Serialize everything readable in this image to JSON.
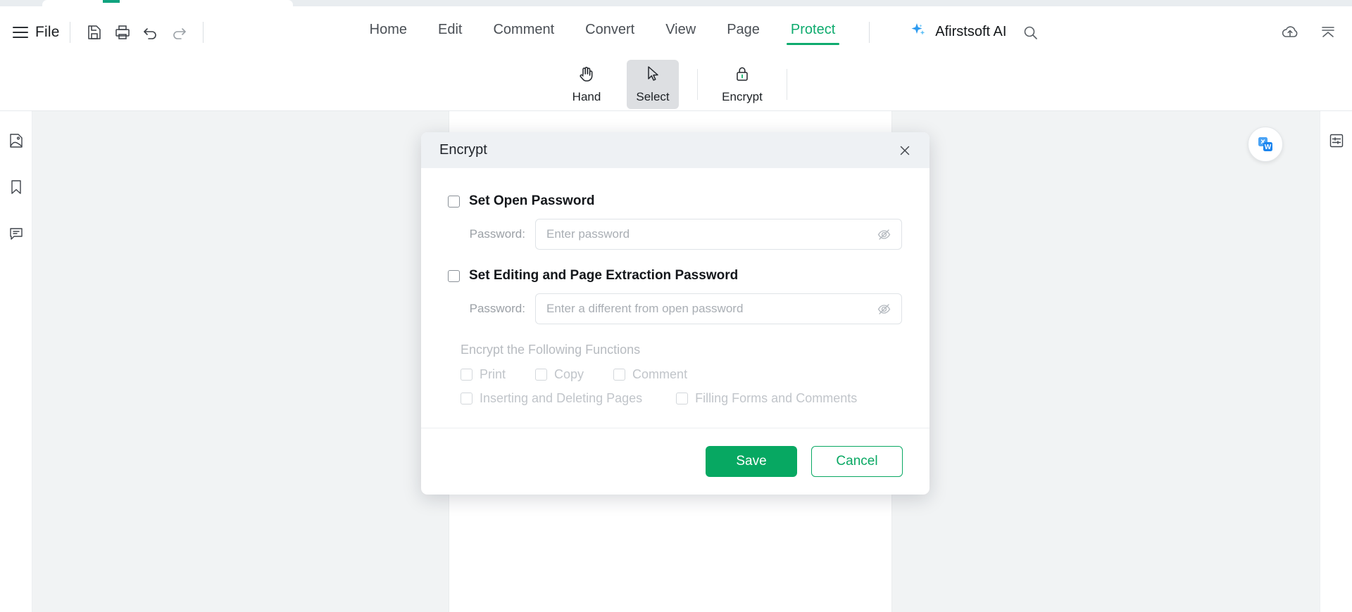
{
  "window": {
    "tab_accent_color": "#10a37f"
  },
  "header": {
    "file_label": "File",
    "icons": {
      "menu": "hamburger-menu-icon",
      "save": "save-file-icon",
      "print": "printer-icon",
      "undo": "undo-arrow-icon",
      "redo": "redo-arrow-icon",
      "search": "search-icon",
      "cloud": "cloud-upload-icon",
      "collapse": "collapse-ribbon-icon"
    },
    "tabs": [
      {
        "label": "Home",
        "active": false
      },
      {
        "label": "Edit",
        "active": false
      },
      {
        "label": "Comment",
        "active": false
      },
      {
        "label": "Convert",
        "active": false
      },
      {
        "label": "View",
        "active": false
      },
      {
        "label": "Page",
        "active": false
      },
      {
        "label": "Protect",
        "active": true
      }
    ],
    "ai": {
      "label": "Afirstsoft AI",
      "icon": "sparkle-ai-icon"
    },
    "accent_color": "#0eab6e"
  },
  "toolbar": {
    "tools": [
      {
        "label": "Hand",
        "icon": "hand-icon",
        "active": false
      },
      {
        "label": "Select",
        "icon": "cursor-arrow-icon",
        "active": true
      },
      {
        "label": "Encrypt",
        "icon": "lock-icon",
        "active": false
      }
    ]
  },
  "left_rail": {
    "items": [
      {
        "icon": "page-thumbnail-icon",
        "name": "thumbnails"
      },
      {
        "icon": "bookmark-icon",
        "name": "bookmarks"
      },
      {
        "icon": "comment-bubble-icon",
        "name": "comments"
      }
    ]
  },
  "right_rail": {
    "items": [
      {
        "icon": "properties-sliders-icon",
        "name": "properties"
      }
    ]
  },
  "canvas": {
    "convert_fab_icon": "pdf-to-word-icon",
    "background_color": "#f1f3f4"
  },
  "dialog": {
    "title": "Encrypt",
    "close_icon": "close-icon",
    "sections": [
      {
        "checkbox_label": "Set Open Password",
        "checked": false,
        "password_label": "Password:",
        "password_placeholder": "Enter password",
        "password_value": "",
        "toggle_icon": "eye-off-icon"
      },
      {
        "checkbox_label": "Set Editing and Page Extraction Password",
        "checked": false,
        "password_label": "Password:",
        "password_placeholder": "Enter a different from open password",
        "password_value": "",
        "toggle_icon": "eye-off-icon"
      }
    ],
    "functions": {
      "title": "Encrypt the Following Functions",
      "row1": [
        {
          "label": "Print",
          "checked": false,
          "disabled": true
        },
        {
          "label": "Copy",
          "checked": false,
          "disabled": true
        },
        {
          "label": "Comment",
          "checked": false,
          "disabled": true
        }
      ],
      "row2": [
        {
          "label": "Inserting and Deleting Pages",
          "checked": false,
          "disabled": true
        },
        {
          "label": "Filling Forms and Comments",
          "checked": false,
          "disabled": true
        }
      ]
    },
    "buttons": {
      "save": "Save",
      "cancel": "Cancel",
      "save_color": "#07a862",
      "cancel_color": "#09a863"
    }
  }
}
